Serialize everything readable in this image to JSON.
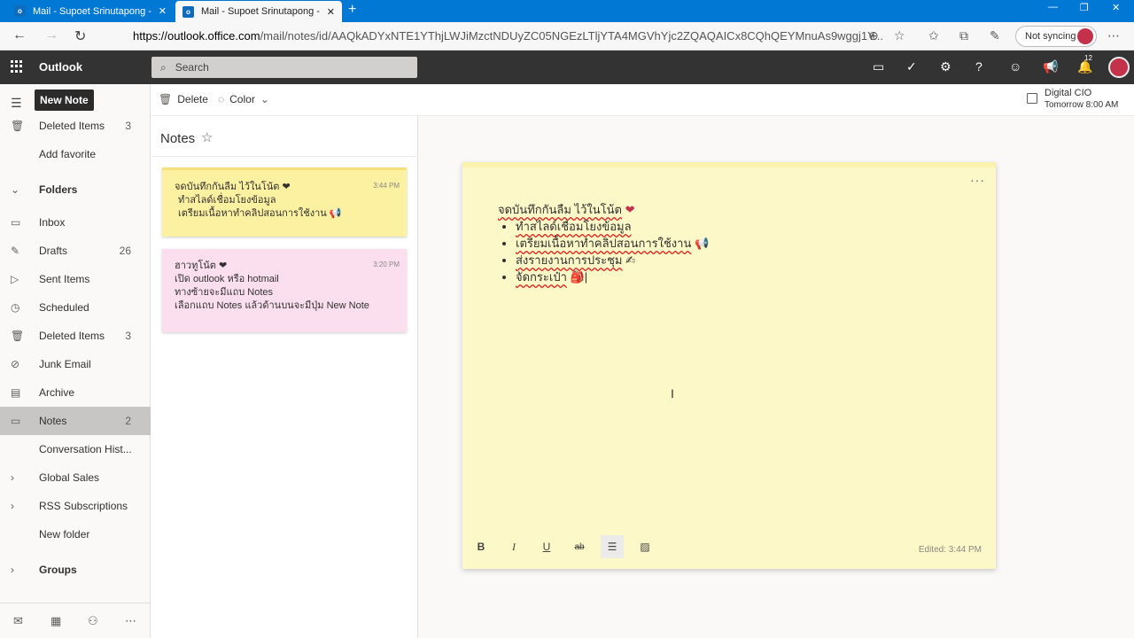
{
  "browser": {
    "tabs": [
      {
        "title": "Mail - Supoet Srinutapong - Out",
        "active": false
      },
      {
        "title": "Mail - Supoet Srinutapong - Out",
        "active": true
      }
    ],
    "url_host": "https://outlook.office.com",
    "url_rest": "/mail/notes/id/AAQkADYxNTE1YThjLWJiMzctNDUyZC05NGEzLTljYTA4MGVhYjc2ZQAQAICx8CQhQEYMnuAs9wggj1Y...",
    "sync_label": "Not syncing"
  },
  "header": {
    "app_name": "Outlook",
    "search_placeholder": "Search",
    "notification_count": "12"
  },
  "nav": {
    "new_note_label": "New Note",
    "items": [
      {
        "label": "Deleted Items",
        "count": "3",
        "icon": "trash-icon"
      },
      {
        "label": "Add favorite",
        "count": "",
        "icon": ""
      },
      {
        "label": "Folders",
        "count": "",
        "icon": "chevron-down-icon"
      },
      {
        "label": "Inbox",
        "count": "",
        "icon": "inbox-icon"
      },
      {
        "label": "Drafts",
        "count": "26",
        "icon": "pencil-icon"
      },
      {
        "label": "Sent Items",
        "count": "",
        "icon": "send-icon"
      },
      {
        "label": "Scheduled",
        "count": "",
        "icon": "clock-icon"
      },
      {
        "label": "Deleted Items",
        "count": "3",
        "icon": "trash-icon"
      },
      {
        "label": "Junk Email",
        "count": "",
        "icon": "block-icon"
      },
      {
        "label": "Archive",
        "count": "",
        "icon": "archive-icon"
      },
      {
        "label": "Notes",
        "count": "2",
        "icon": "note-icon"
      },
      {
        "label": "Conversation Hist...",
        "count": "",
        "icon": ""
      },
      {
        "label": "Global Sales",
        "count": "",
        "icon": "chevron-right-icon"
      },
      {
        "label": "RSS Subscriptions",
        "count": "",
        "icon": "chevron-right-icon"
      },
      {
        "label": "New folder",
        "count": "",
        "icon": ""
      },
      {
        "label": "Groups",
        "count": "",
        "icon": "chevron-right-icon"
      }
    ]
  },
  "toolbar": {
    "delete_label": "Delete",
    "color_label": "Color",
    "reminder_title": "Digital CIO",
    "reminder_time": "Tomorrow 8:00 AM"
  },
  "notes_list": {
    "title": "Notes",
    "notes": [
      {
        "time": "3:44 PM",
        "color": "#fcf0a1",
        "lines": [
          "จดบันทึกกันลืม ไว้ในโน้ต ❤",
          "ทำสไลด์เชื่อมโยงข้อมูล",
          "เตรียมเนื้อหาทำคลิปสอนการใช้งาน 📢"
        ]
      },
      {
        "time": "3:20 PM",
        "color": "#fbdfef",
        "lines": [
          "ฮาวทูโน้ต ❤",
          "เปิด outlook หรือ hotmail",
          "ทางซ้ายจะมีแถบ Notes",
          "เลือกแถบ Notes แล้วด้านบนจะมีปุ่ม New Note"
        ]
      }
    ]
  },
  "editor": {
    "title": "จดบันทึกกันลืม ไว้ในโน้ต",
    "title_emoji": "❤",
    "bullets": [
      {
        "text": "ทำสไลด์เชื่อมโยงข้อมูล",
        "emoji": ""
      },
      {
        "text": "เตรียมเนื้อหาทำคลิปสอนการใช้งาน",
        "emoji": "📢"
      },
      {
        "text": "ส่งรายงานการประชุม",
        "emoji": "✍"
      },
      {
        "text": "จัดกระเป๋า",
        "emoji": "🎒"
      }
    ],
    "edited_label": "Edited: 3:44 PM",
    "format_buttons": {
      "bold": "B",
      "italic": "I",
      "underline": "U",
      "strike": "ab"
    }
  }
}
